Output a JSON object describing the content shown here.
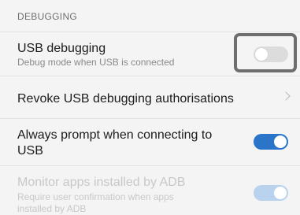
{
  "section": {
    "header": "DEBUGGING"
  },
  "items": [
    {
      "title": "USB debugging",
      "subtitle": "Debug mode when USB is connected",
      "toggle": "off"
    },
    {
      "title": "Revoke USB debugging authorisations"
    },
    {
      "title_line1": "Always prompt when connecting to",
      "title_line2": "USB",
      "toggle": "on"
    },
    {
      "title": "Monitor apps installed by ADB",
      "subtitle_line1": "Require user confirmation when apps",
      "subtitle_line2": "installed by ADB",
      "toggle": "on",
      "disabled": true
    }
  ],
  "icons": {
    "chevron": "chevron-right-icon"
  },
  "colors": {
    "toggle_on": "#2a74c9",
    "toggle_off": "#dcdcdc",
    "highlight": "#6e6e6e"
  }
}
